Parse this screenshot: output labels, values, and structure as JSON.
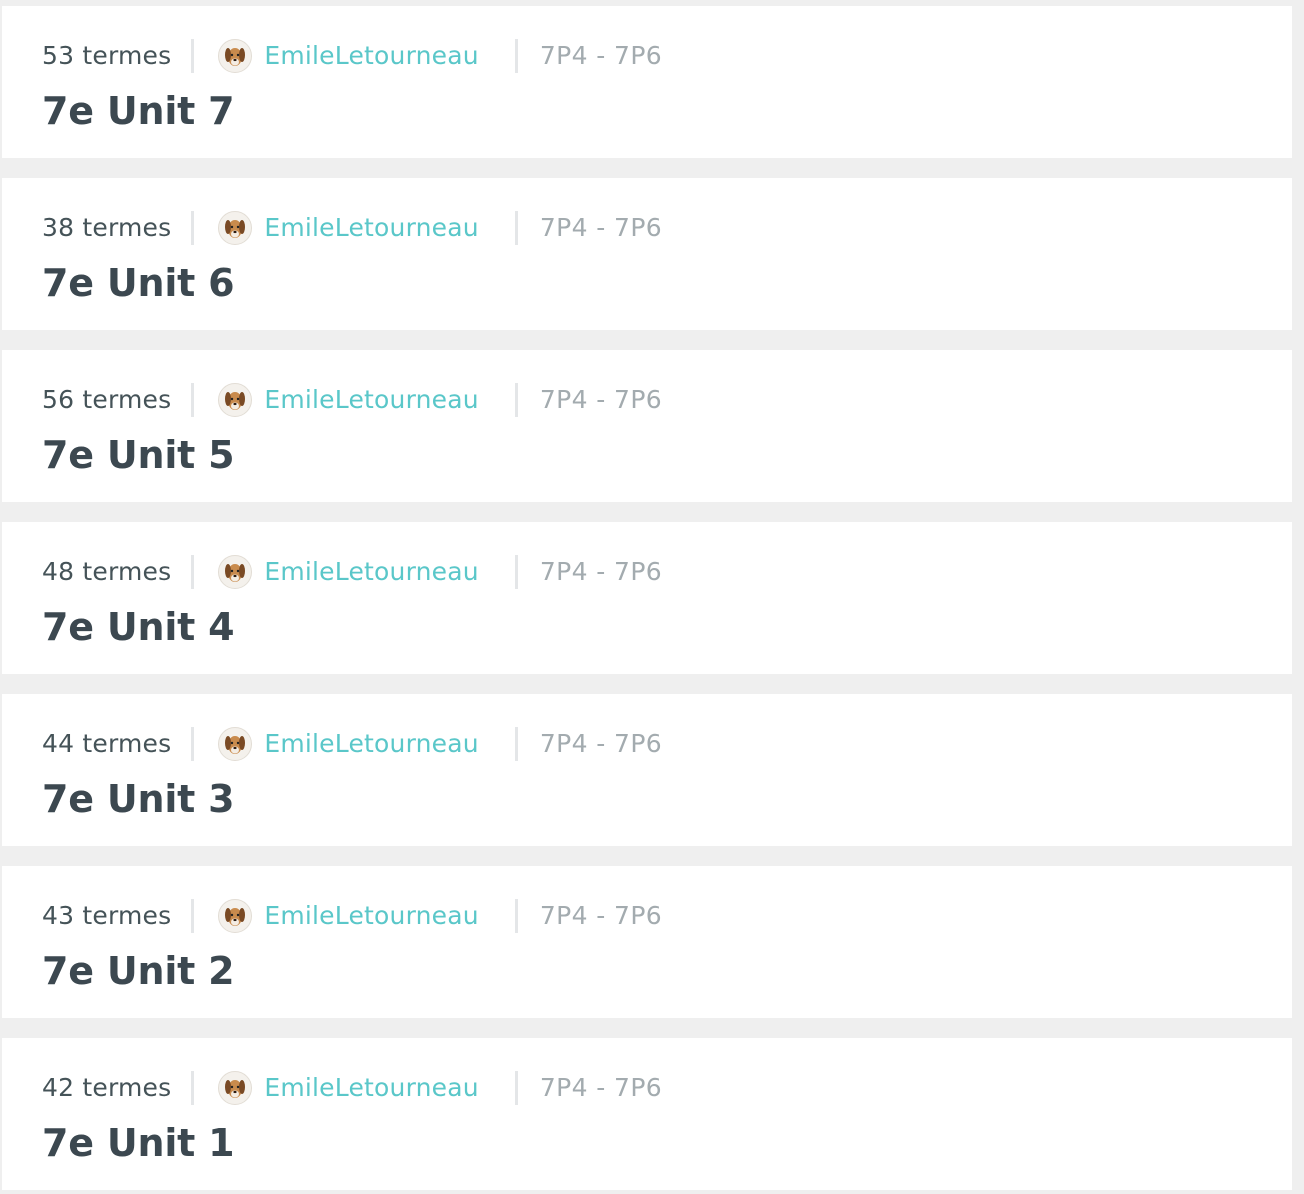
{
  "sets": [
    {
      "count": "53 termes",
      "author": "EmileLetourneau",
      "class": "7P4 - 7P6",
      "title": "7e Unit 7"
    },
    {
      "count": "38 termes",
      "author": "EmileLetourneau",
      "class": "7P4 - 7P6",
      "title": "7e Unit 6"
    },
    {
      "count": "56 termes",
      "author": "EmileLetourneau",
      "class": "7P4 - 7P6",
      "title": "7e Unit 5"
    },
    {
      "count": "48 termes",
      "author": "EmileLetourneau",
      "class": "7P4 - 7P6",
      "title": "7e Unit 4"
    },
    {
      "count": "44 termes",
      "author": "EmileLetourneau",
      "class": "7P4 - 7P6",
      "title": "7e Unit 3"
    },
    {
      "count": "43 termes",
      "author": "EmileLetourneau",
      "class": "7P4 - 7P6",
      "title": "7e Unit 2"
    },
    {
      "count": "42 termes",
      "author": "EmileLetourneau",
      "class": "7P4 - 7P6",
      "title": "7e Unit 1"
    }
  ],
  "colors": {
    "background": "#efefef",
    "card": "#ffffff",
    "author_link": "#5ac7c9",
    "title": "#3c4850",
    "muted": "#a3abaf"
  },
  "icons": {
    "avatar": "dog-avatar-icon"
  }
}
